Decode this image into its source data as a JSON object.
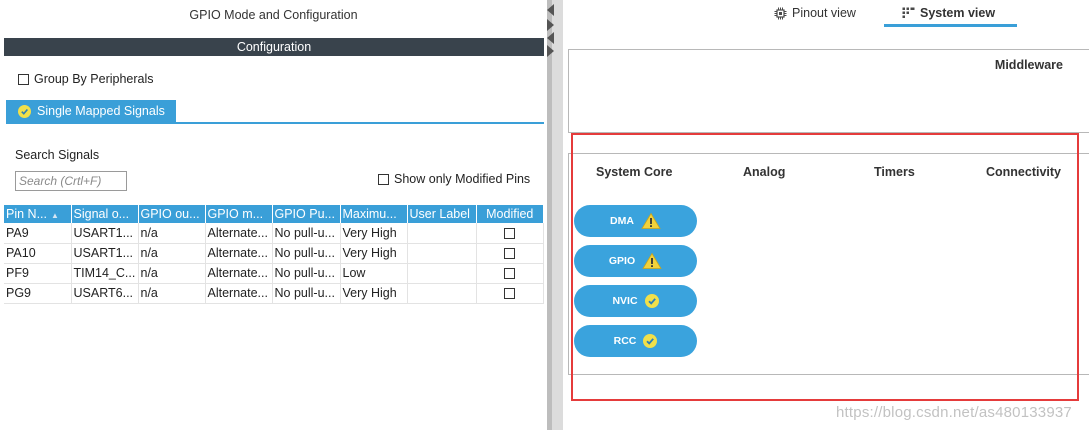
{
  "left": {
    "title": "GPIO Mode and Configuration",
    "config_label": "Configuration",
    "group_by_label": "Group By Peripherals",
    "tab_label": "Single Mapped Signals",
    "search_label": "Search Signals",
    "search_placeholder": "Search (Crtl+F)",
    "show_modified_label": "Show only Modified Pins",
    "table": {
      "columns": [
        "Pin N...",
        "Signal o...",
        "GPIO ou...",
        "GPIO m...",
        "GPIO Pu...",
        "Maximu...",
        "User Label",
        "Modified"
      ],
      "rows": [
        [
          "PA9",
          "USART1...",
          "n/a",
          "Alternate...",
          "No pull-u...",
          "Very High",
          "",
          ""
        ],
        [
          "PA10",
          "USART1...",
          "n/a",
          "Alternate...",
          "No pull-u...",
          "Very High",
          "",
          ""
        ],
        [
          "PF9",
          "TIM14_C...",
          "n/a",
          "Alternate...",
          "No pull-u...",
          "Low",
          "",
          ""
        ],
        [
          "PG9",
          "USART6...",
          "n/a",
          "Alternate...",
          "No pull-u...",
          "Very High",
          "",
          ""
        ]
      ]
    }
  },
  "right": {
    "tabs": {
      "pinout": "Pinout view",
      "system": "System view"
    },
    "middleware_title": "Middleware",
    "categories": [
      "System Core",
      "Analog",
      "Timers",
      "Connectivity"
    ],
    "system_core_items": [
      {
        "label": "DMA",
        "status": "warning"
      },
      {
        "label": "GPIO",
        "status": "warning"
      },
      {
        "label": "NVIC",
        "status": "ok"
      },
      {
        "label": "RCC",
        "status": "ok"
      }
    ]
  },
  "watermark": "https://blog.csdn.net/as480133937",
  "colors": {
    "accent": "#3a9fd8",
    "header_dark": "#39434c",
    "highlight": "#e53b3b",
    "status_ok": "#f1e04a",
    "status_warning": "#f2d23a"
  }
}
